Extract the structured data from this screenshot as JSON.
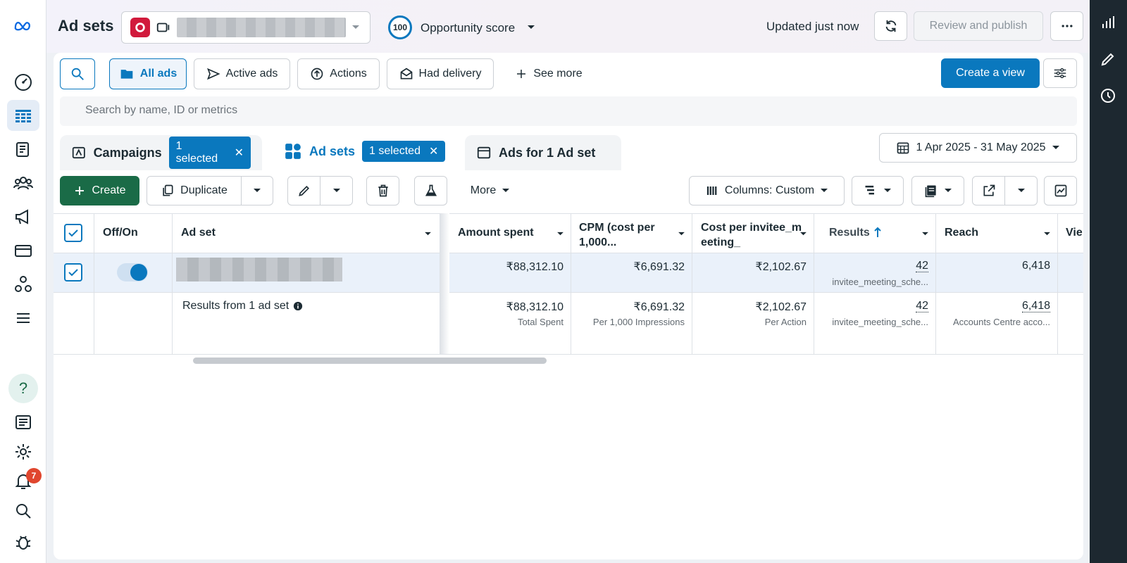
{
  "header": {
    "title": "Ad sets",
    "opportunity_score": "100",
    "opportunity_label": "Opportunity score",
    "updated": "Updated just now",
    "review_publish": "Review and publish"
  },
  "filters": {
    "all_ads": "All ads",
    "active_ads": "Active ads",
    "actions": "Actions",
    "had_delivery": "Had delivery",
    "see_more": "See more",
    "create_view": "Create a view"
  },
  "search": {
    "placeholder": "Search by name, ID or metrics"
  },
  "tabs": {
    "campaigns": "Campaigns",
    "campaigns_chip": "1 selected",
    "adsets": "Ad sets",
    "adsets_chip": "1 selected",
    "ads": "Ads for 1 Ad set"
  },
  "date_range": "1 Apr 2025 - 31 May 2025",
  "toolbar": {
    "create": "Create",
    "duplicate": "Duplicate",
    "more": "More",
    "columns": "Columns: Custom"
  },
  "table": {
    "headers": {
      "offon": "Off/On",
      "adset": "Ad set",
      "amount_spent": "Amount spent",
      "cpm": "CPM (cost per 1,000...",
      "cost_per": "Cost per invitee_meeting_",
      "results": "Results",
      "reach": "Reach",
      "views": "Vie"
    },
    "row": {
      "amount_spent": "₹88,312.10",
      "cpm": "₹6,691.32",
      "cost_per": "₹2,102.67",
      "results": "42",
      "results_sub": "invitee_meeting_sche...",
      "reach": "6,418"
    },
    "summary": {
      "label": "Results from 1 ad set",
      "amount_spent": "₹88,312.10",
      "amount_spent_sub": "Total Spent",
      "cpm": "₹6,691.32",
      "cpm_sub": "Per 1,000 Impressions",
      "cost_per": "₹2,102.67",
      "cost_per_sub": "Per Action",
      "results": "42",
      "results_sub": "invitee_meeting_sche...",
      "reach": "6,418",
      "reach_sub": "Accounts Centre acco..."
    }
  },
  "notifications_count": "7",
  "colors": {
    "accent": "#0a78be",
    "create_green": "#1a6b47",
    "rail": "#1d2830"
  }
}
